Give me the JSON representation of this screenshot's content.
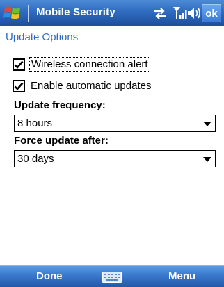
{
  "titlebar": {
    "app_title": "Mobile Security",
    "ok_label": "ok",
    "icons": [
      "windows-flag-icon",
      "connectivity-icon",
      "signal-strength-icon",
      "volume-icon"
    ]
  },
  "page": {
    "heading": "Update Options"
  },
  "options": {
    "wireless_alert": {
      "label": "Wireless connection alert",
      "checked": true
    },
    "auto_updates": {
      "label": "Enable automatic updates",
      "checked": true
    }
  },
  "fields": {
    "update_frequency": {
      "label": "Update frequency:",
      "value": "8 hours"
    },
    "force_update": {
      "label": "Force update after:",
      "value": "30 days"
    }
  },
  "softkeys": {
    "left": "Done",
    "center_icon": "keyboard-icon",
    "right": "Menu"
  },
  "colors": {
    "titlebar": "#2f6bbf",
    "heading": "#2f69c8",
    "softbar": "#3a78cc"
  }
}
